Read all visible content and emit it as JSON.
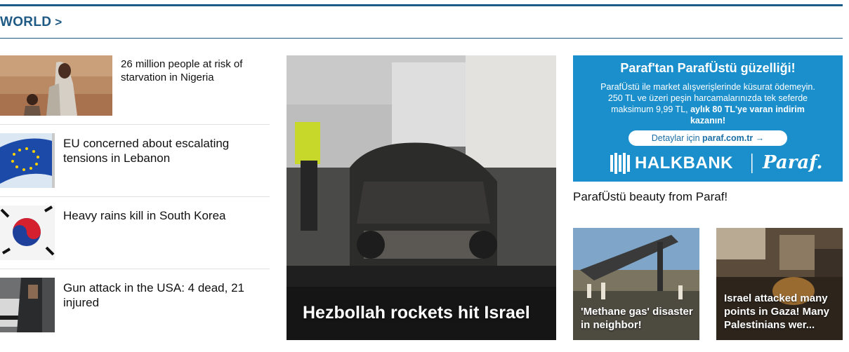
{
  "section": {
    "title": "WORLD",
    "chevron": ">"
  },
  "news_list": [
    {
      "title": "26 million people at risk of starvation in Nigeria"
    },
    {
      "title": "EU concerned about escalating tensions in Lebanon"
    },
    {
      "title": "Heavy rains kill in South Korea"
    },
    {
      "title": "Gun attack in the USA: 4 dead, 21 injured"
    }
  ],
  "featured": {
    "title": "Hezbollah rockets hit Israel"
  },
  "ad": {
    "headline": "Paraf'tan ParafÜstü güzelliği!",
    "body_plain": "ParafÜstü ile market alışverişlerinde küsurat ödemeyin. 250 TL ve üzeri peşin harcamalarınızda tek seferde maksimum 9,99 TL,",
    "body_bold": "aylık 80 TL'ye varan indirim kazanın!",
    "button_prefix": "Detaylar için",
    "button_link": "paraf.com.tr",
    "button_arrow": "→",
    "bank_name": "HALKBANK",
    "brand_name": "Paraf.",
    "caption": "ParafÜstü beauty from Paraf!"
  },
  "small_cards": [
    {
      "title": "'Methane gas' disaster in neighbor!"
    },
    {
      "title": "Israel attacked many points in Gaza! Many Palestinians wer..."
    }
  ],
  "colors": {
    "accent": "#1d5b86",
    "ad_bg": "#1a8fcb"
  }
}
